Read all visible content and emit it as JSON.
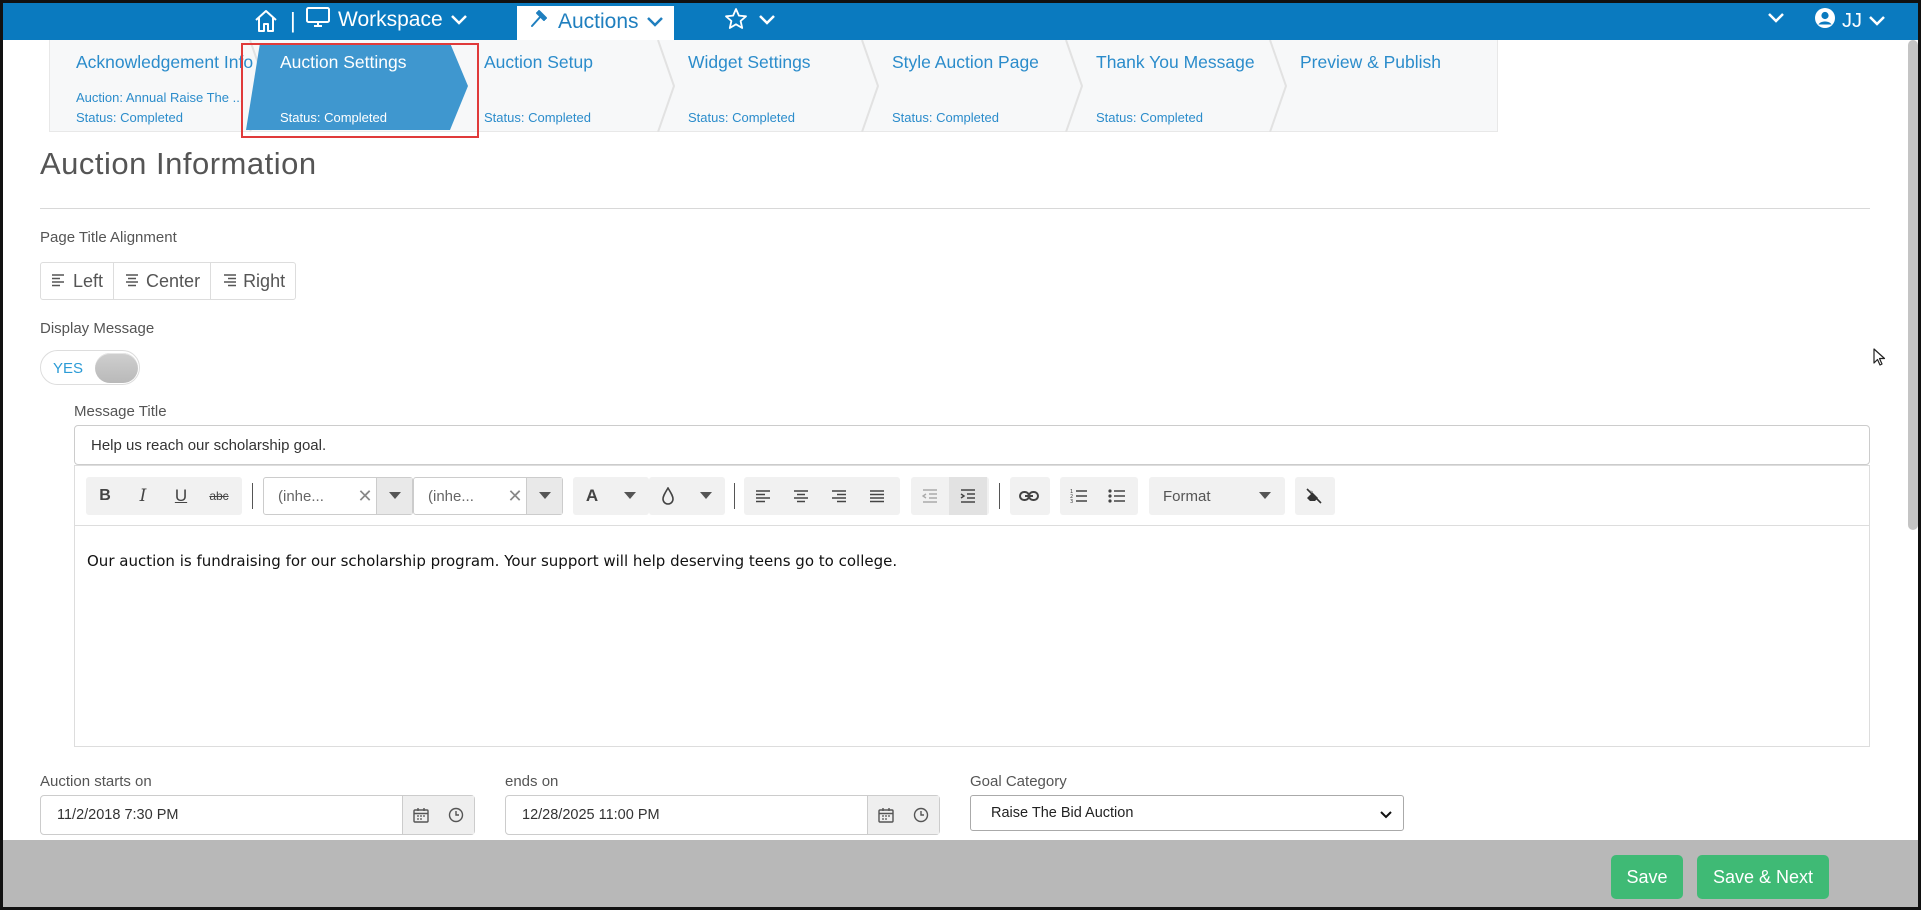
{
  "topbar": {
    "workspace_label": "Workspace",
    "auctions_label": "Auctions",
    "user_initials": "JJ",
    "separator": "|",
    "bar_color": "#0a7abf"
  },
  "wizard": {
    "steps": [
      {
        "title": "Acknowledgement Info",
        "subtitle": "Auction: Annual Raise The ...",
        "status": "Status: Completed"
      },
      {
        "title": "Auction Settings",
        "subtitle": "",
        "status": "Status: Completed"
      },
      {
        "title": "Auction Setup",
        "subtitle": "",
        "status": "Status: Completed"
      },
      {
        "title": "Widget Settings",
        "subtitle": "",
        "status": "Status: Completed"
      },
      {
        "title": "Style Auction Page",
        "subtitle": "",
        "status": "Status: Completed"
      },
      {
        "title": "Thank You Message",
        "subtitle": "",
        "status": "Status: Completed"
      },
      {
        "title": "Preview & Publish",
        "subtitle": "",
        "status": ""
      }
    ],
    "active_index": 1,
    "active_color": "#3f97cf"
  },
  "form": {
    "section_title": "Auction Information",
    "page_title_alignment_label": "Page Title Alignment",
    "alignment_options": [
      "Left",
      "Center",
      "Right"
    ],
    "display_message_label": "Display Message",
    "display_message_toggle": "YES",
    "message_title_label": "Message Title",
    "message_title_value": "Help us reach our scholarship goal.",
    "editor": {
      "font_family": "(inhe...",
      "font_size": "(inhe...",
      "format_label": "Format",
      "body_text": "Our auction is fundraising for our scholarship program. Your support will help deserving teens go to college."
    },
    "starts_label": "Auction starts on",
    "starts_value": "11/2/2018 7:30 PM",
    "ends_label": "ends on",
    "ends_value": "12/28/2025 11:00 PM",
    "goal_category_label": "Goal Category",
    "goal_category_value": "Raise The Bid Auction"
  },
  "footer": {
    "save_label": "Save",
    "save_next_label": "Save & Next",
    "button_color": "#3fba75"
  }
}
